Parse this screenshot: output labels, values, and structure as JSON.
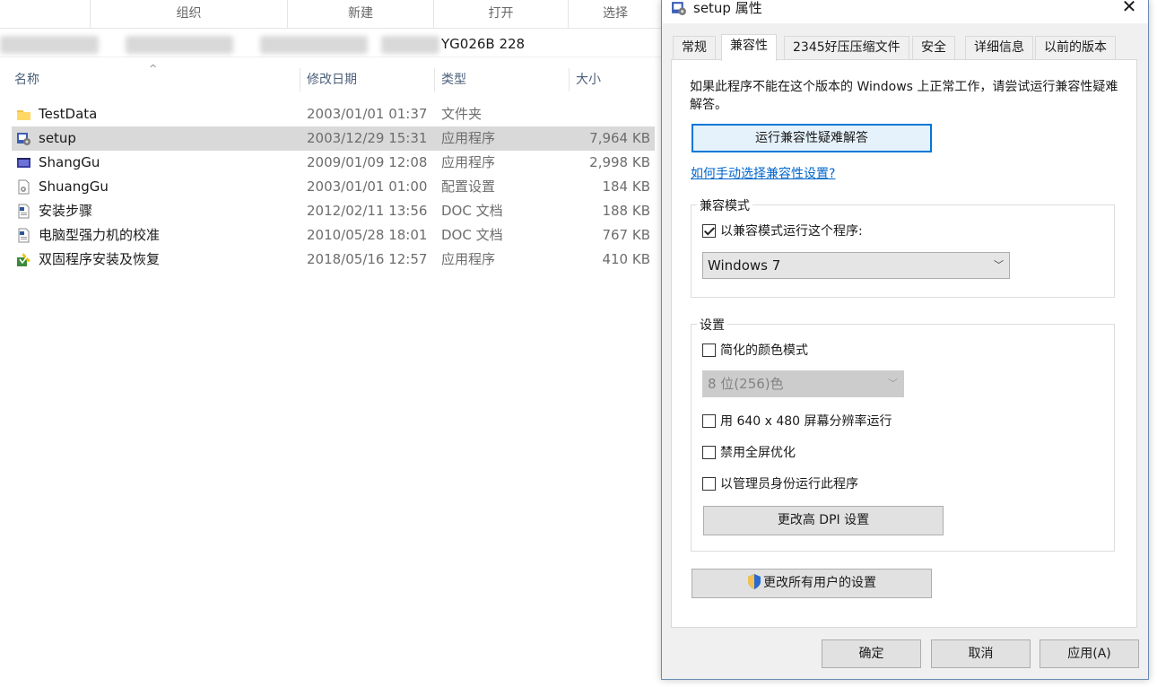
{
  "explorer": {
    "ribbon_groups": [
      "组织",
      "新建",
      "打开",
      "选择"
    ],
    "address_visible_text": "YG026B 228",
    "columns": {
      "name": "名称",
      "date": "修改日期",
      "type": "类型",
      "size": "大小"
    },
    "files": [
      {
        "name": "TestData",
        "date": "2003/01/01 01:37",
        "type": "文件夹",
        "size": "",
        "icon": "folder-icon"
      },
      {
        "name": "setup",
        "date": "2003/12/29 15:31",
        "type": "应用程序",
        "size": "7,964 KB",
        "icon": "setup-exe-icon",
        "selected": true
      },
      {
        "name": "ShangGu",
        "date": "2009/01/09 12:08",
        "type": "应用程序",
        "size": "2,998 KB",
        "icon": "app-window-icon"
      },
      {
        "name": "ShuangGu",
        "date": "2003/01/01 01:00",
        "type": "配置设置",
        "size": "184 KB",
        "icon": "config-file-icon"
      },
      {
        "name": "安装步骤",
        "date": "2012/02/11 13:56",
        "type": "DOC 文档",
        "size": "188 KB",
        "icon": "doc-file-icon"
      },
      {
        "name": "电脑型强力机的校准",
        "date": "2010/05/28 18:01",
        "type": "DOC 文档",
        "size": "767 KB",
        "icon": "doc-file-icon"
      },
      {
        "name": "双固程序安装及恢复",
        "date": "2018/05/16 12:57",
        "type": "应用程序",
        "size": "410 KB",
        "icon": "installer-icon"
      }
    ]
  },
  "dialog": {
    "title": "setup 属性",
    "close_label": "✕",
    "tabs": [
      "常规",
      "兼容性",
      "2345好压压缩文件",
      "安全",
      "详细信息",
      "以前的版本"
    ],
    "active_tab": "兼容性",
    "intro_text": "如果此程序不能在这个版本的 Windows 上正常工作，请尝试运行兼容性疑难解答。",
    "troubleshoot_button": "运行兼容性疑难解答",
    "manual_link": "如何手动选择兼容性设置?",
    "compat_mode": {
      "group_label": "兼容模式",
      "checkbox_label": "以兼容模式运行这个程序:",
      "checked": true,
      "os_selected": "Windows 7"
    },
    "settings": {
      "group_label": "设置",
      "reduced_color_label": "简化的颜色模式",
      "reduced_color_checked": false,
      "color_depth_selected": "8 位(256)色",
      "res_640_label": "用 640 x 480 屏幕分辨率运行",
      "res_640_checked": false,
      "disable_fullscreen_label": "禁用全屏优化",
      "disable_fullscreen_checked": false,
      "run_as_admin_label": "以管理员身份运行此程序",
      "run_as_admin_checked": false,
      "dpi_button": "更改高 DPI 设置"
    },
    "all_users_button": "更改所有用户的设置",
    "ok_button": "确定",
    "cancel_button": "取消",
    "apply_button": "应用(A)",
    "colors": {
      "link": "#0066cc",
      "focus_border": "#0078d7",
      "selection_bg": "#d9d9d9"
    }
  }
}
